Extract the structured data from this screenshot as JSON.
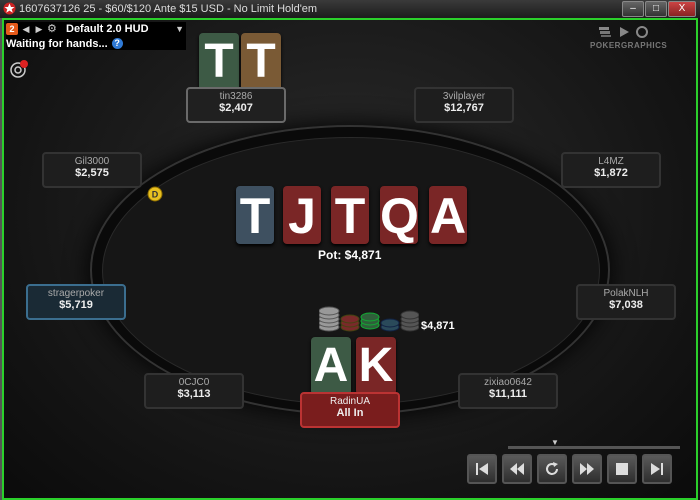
{
  "window": {
    "title": "1607637126 25 - $60/$120 Ante $15 USD - No Limit Hold'em",
    "minimize": "–",
    "maximize": "□",
    "close": "X"
  },
  "hud": {
    "badge": "2",
    "name": "Default 2.0 HUD",
    "status": "Waiting for hands...",
    "help": "?"
  },
  "branding": {
    "label": "POKERGRAPHICS"
  },
  "seats": [
    {
      "id": "tin3286",
      "name": "tin3286",
      "stack": "$2,407"
    },
    {
      "id": "3vilplayer",
      "name": "3vilplayer",
      "stack": "$12,767"
    },
    {
      "id": "gil3000",
      "name": "Gil3000",
      "stack": "$2,575"
    },
    {
      "id": "l4mz",
      "name": "L4MZ",
      "stack": "$1,872"
    },
    {
      "id": "stragerpoker",
      "name": "stragerpoker",
      "stack": "$5,719"
    },
    {
      "id": "polaknlh",
      "name": "PolakNLH",
      "stack": "$7,038"
    },
    {
      "id": "0cjc0",
      "name": "0CJC0",
      "stack": "$3,113"
    },
    {
      "id": "zixiao0642",
      "name": "zixiao0642",
      "stack": "$11,111"
    },
    {
      "id": "radinua",
      "name": "RadinUA",
      "stack": "All In"
    }
  ],
  "opponent_cards": [
    "T",
    "T"
  ],
  "board": [
    "T",
    "J",
    "T",
    "Q",
    "A"
  ],
  "hero_cards": [
    "A",
    "K"
  ],
  "pot": "Pot: $4,871",
  "chip_amount": "$4,871",
  "colors": {
    "green": "#3d5a45",
    "red": "#7a2626",
    "blue": "#3e5060",
    "orange": "#7a5a35",
    "gray": "#5a5a5a",
    "frame": "#2bd02b"
  }
}
